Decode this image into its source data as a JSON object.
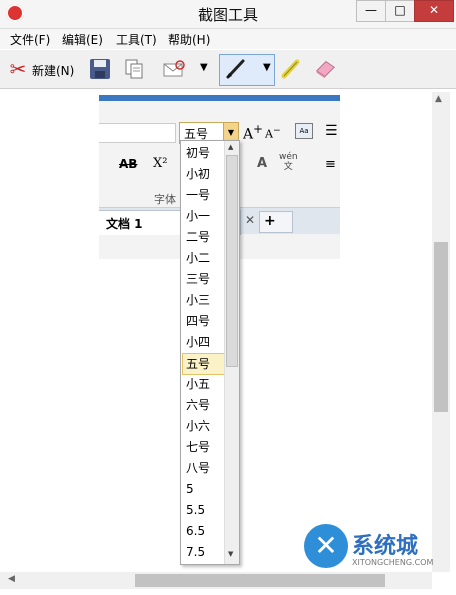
{
  "window": {
    "title": "截图工具",
    "minimize": "—",
    "maximize": "□",
    "close": "✕"
  },
  "menu": [
    "文件(F)",
    "编辑(E)",
    "工具(T)",
    "帮助(H)"
  ],
  "toolbar": {
    "new_label": "新建(N)",
    "icons": [
      "scissors-icon",
      "save-icon",
      "copy-icon",
      "send-icon",
      "pen-icon",
      "highlighter-icon",
      "eraser-icon"
    ]
  },
  "snip": {
    "font_size_value": "五号",
    "grow_font": "A",
    "grow_font_sup": "+",
    "shrink_font": "A",
    "shrink_font_sup": "−",
    "clear_format": "Aa",
    "strikethrough": "AB",
    "superscript": "X²",
    "font_color": "A",
    "phonetic_top": "wén",
    "phonetic_char": "文",
    "font_group_label": "字体",
    "doc_tab_label": "文档 1",
    "doc_tab_close": "✕",
    "new_tab": "+"
  },
  "font_size_options": [
    "初号",
    "小初",
    "一号",
    "小一",
    "二号",
    "小二",
    "三号",
    "小三",
    "四号",
    "小四",
    "五号",
    "小五",
    "六号",
    "小六",
    "七号",
    "八号",
    "5",
    "5.5",
    "6.5",
    "7.5"
  ],
  "selected_option": "五号",
  "watermark": {
    "text": "系统城",
    "sub": "XITONGCHENG.COM"
  },
  "colors": {
    "selection_bg": "#fcf2c8",
    "accent_blue": "#3a78c2",
    "close_red": "#c43c3c"
  }
}
